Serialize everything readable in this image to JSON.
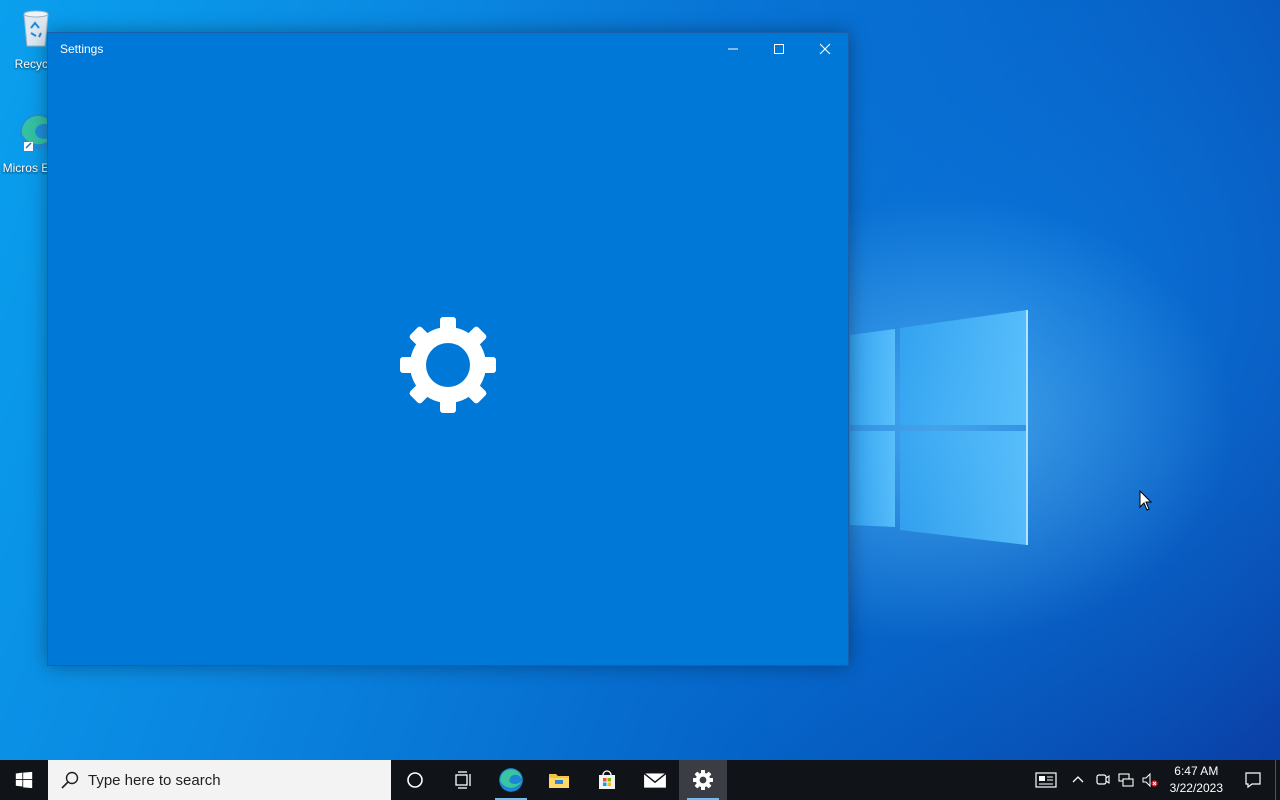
{
  "desktop": {
    "icons": [
      {
        "label": "Recycle",
        "icon": "recycle-bin-icon"
      },
      {
        "label": "Micros Edge",
        "icon": "edge-icon"
      }
    ]
  },
  "window": {
    "title": "Settings",
    "buttons": {
      "minimize": "minimize-icon",
      "maximize": "maximize-icon",
      "close": "close-icon"
    },
    "splash_icon": "gear-icon",
    "background": "#0078d7"
  },
  "taskbar": {
    "search_placeholder": "Type here to search",
    "apps": [
      "cortana-icon",
      "task-view-icon",
      "edge-icon",
      "file-explorer-icon",
      "store-icon",
      "mail-icon",
      "settings-icon"
    ],
    "active_app": "settings-icon",
    "tray": {
      "time": "6:47 AM",
      "date": "3/22/2023",
      "icons": [
        "news-icon",
        "chevron-up-icon",
        "meet-now-icon",
        "network-icon",
        "volume-muted-icon",
        "notification-icon"
      ]
    }
  }
}
